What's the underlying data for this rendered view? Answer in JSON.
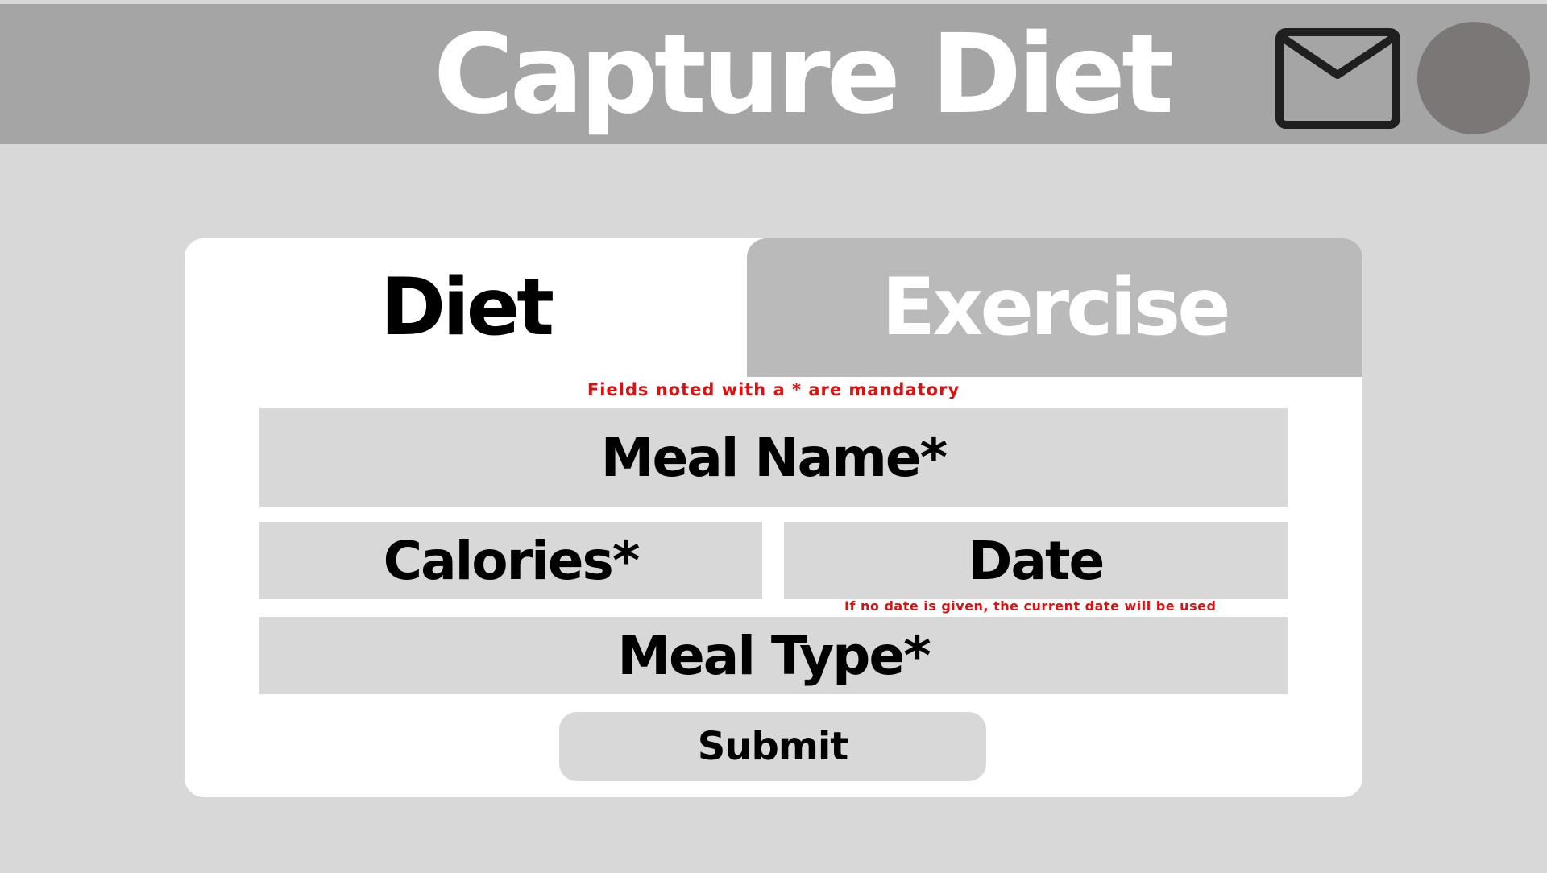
{
  "header": {
    "title": "Capture Diet",
    "mail_icon": "mail-icon",
    "avatar": "user-avatar"
  },
  "tabs": [
    {
      "label": "Diet",
      "active": true
    },
    {
      "label": "Exercise",
      "active": false
    }
  ],
  "form": {
    "mandatory_note": "Fields noted with a * are mandatory",
    "meal_name_placeholder": "Meal Name*",
    "calories_placeholder": "Calories*",
    "date_placeholder": "Date",
    "date_note": "If no date is given, the current date will be used",
    "meal_type_placeholder": "Meal Type*",
    "submit_label": "Submit"
  },
  "colors": {
    "header_bg": "#a5a5a5",
    "page_bg": "#d8d8d8",
    "card_bg": "#ffffff",
    "inactive_tab_bg": "#bababa",
    "field_bg": "#d8d8d8",
    "note_text": "#e01010",
    "avatar": "#7b7777",
    "icon": "#1f1f1f"
  }
}
